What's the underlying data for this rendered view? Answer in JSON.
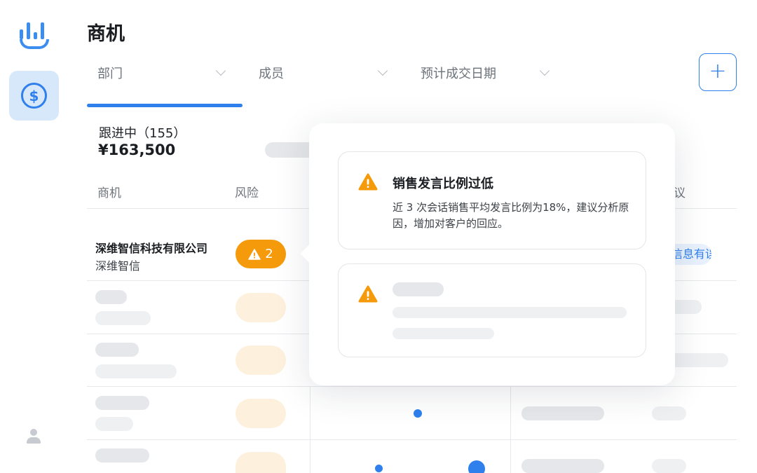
{
  "app": {
    "page_title": "商机"
  },
  "sidebar": {
    "logo_icon": "bar-chart-smile-logo",
    "items": [
      {
        "icon": "dollar-coin-icon",
        "glyph": "$",
        "active": true
      },
      {
        "icon": "user-icon",
        "active": false
      }
    ]
  },
  "filters": [
    {
      "label": "部门"
    },
    {
      "label": "成员"
    },
    {
      "label": "预计成交日期"
    }
  ],
  "add_button": {
    "glyph": "+"
  },
  "stage": {
    "name": "跟进中（155）",
    "amount": "¥163,500"
  },
  "table": {
    "columns": {
      "deal": "商机",
      "risk": "风险",
      "objection": "异议"
    },
    "rows": [
      {
        "company": "深维智信科技有限公司",
        "short_name": "深维智信",
        "risk_count": "2",
        "objection_tag": "信息有误"
      }
    ]
  },
  "popover": {
    "cards": [
      {
        "icon": "warning-triangle-icon",
        "title": "销售发言比例过低",
        "description": "近 3 次会话销售平均发言比例为18%，建议分析原因，增加对客户的回应。"
      },
      {
        "icon": "warning-triangle-icon",
        "loading": true
      }
    ]
  },
  "colors": {
    "accent": "#2f80ed",
    "warning": "#f59a0b",
    "active_nav_bg": "#d8e8fb",
    "skeleton": "#e5e7ea"
  }
}
